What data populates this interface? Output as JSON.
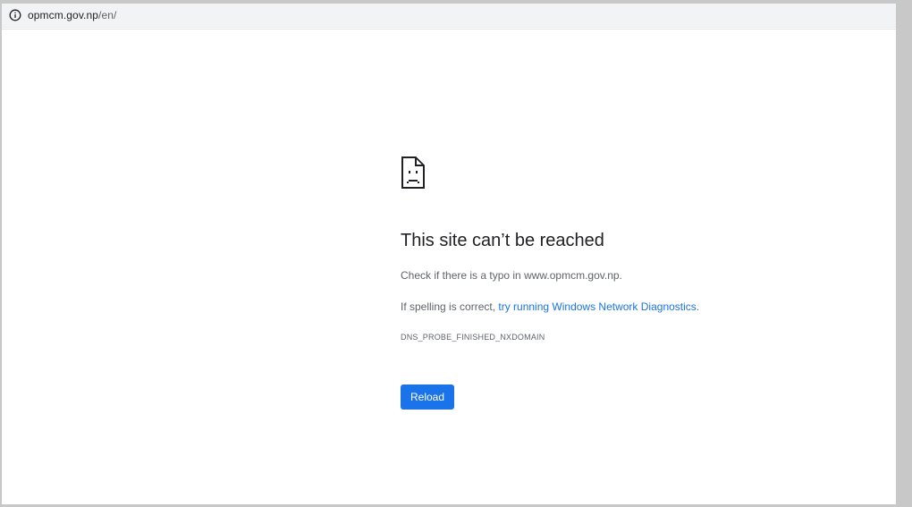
{
  "omnibox": {
    "icon": "info-icon",
    "host": "opmcm.gov.np",
    "path": "/en/"
  },
  "error": {
    "icon": "sad-page-icon",
    "title": "This site can’t be reached",
    "line1": "Check if there is a typo in www.opmcm.gov.np.",
    "line2_prefix": "If spelling is correct, ",
    "line2_link": "try running Windows Network Diagnostics",
    "line2_suffix": ".",
    "code": "DNS_PROBE_FINISHED_NXDOMAIN",
    "reload_label": "Reload"
  },
  "colors": {
    "accent": "#1a73e8",
    "text": "#202124",
    "secondary_text": "#5f6368"
  }
}
